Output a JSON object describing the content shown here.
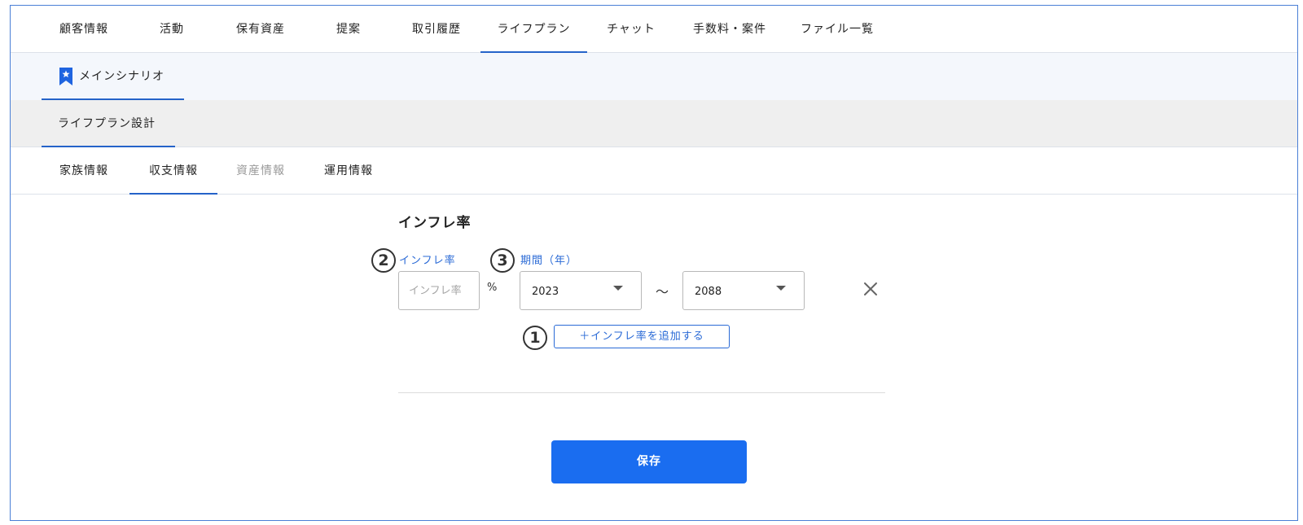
{
  "topnav": {
    "tabs": [
      {
        "label": "顧客情報"
      },
      {
        "label": "活動"
      },
      {
        "label": "保有資産"
      },
      {
        "label": "提案"
      },
      {
        "label": "取引履歴"
      },
      {
        "label": "ライフプラン",
        "active": true
      },
      {
        "label": "チャット"
      },
      {
        "label": "手数料・案件"
      },
      {
        "label": "ファイル一覧"
      }
    ]
  },
  "scenario": {
    "label": "メインシナリオ",
    "icon": "bookmark-star-icon"
  },
  "plan": {
    "label": "ライフプラン設計"
  },
  "subtabs": [
    {
      "label": "家族情報"
    },
    {
      "label": "収支情報",
      "active": true
    },
    {
      "label": "資産情報",
      "disabled": true
    },
    {
      "label": "運用情報"
    }
  ],
  "inflation": {
    "title": "インフレ率",
    "rate_label": "インフレ率",
    "rate_placeholder": "インフレ率",
    "rate_unit": "%",
    "period_label": "期間（年）",
    "start_year": "2023",
    "range_separator": "～",
    "end_year": "2088",
    "add_label": "＋インフレ率を追加する"
  },
  "annotations": {
    "one": "1",
    "two": "2",
    "three": "3"
  },
  "save_label": "保存",
  "colors": {
    "accent": "#2563c9",
    "primary_button": "#1a6df0",
    "label": "#2a6ad6"
  }
}
